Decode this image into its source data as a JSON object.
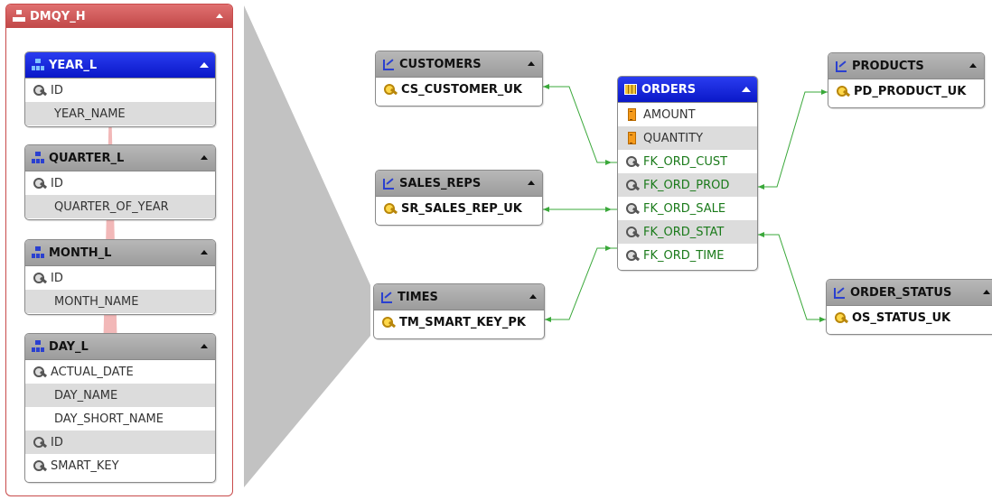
{
  "hierarchy": {
    "title": "DMQY_H",
    "levels": [
      {
        "name": "YEAR_L",
        "attributes": [
          "ID",
          "YEAR_NAME"
        ]
      },
      {
        "name": "QUARTER_L",
        "attributes": [
          "ID",
          "QUARTER_OF_YEAR"
        ]
      },
      {
        "name": "MONTH_L",
        "attributes": [
          "ID",
          "MONTH_NAME"
        ]
      },
      {
        "name": "DAY_L",
        "attributes": [
          "ACTUAL_DATE",
          "DAY_NAME",
          "DAY_SHORT_NAME",
          "ID",
          "SMART_KEY"
        ]
      }
    ]
  },
  "fact": {
    "name": "ORDERS",
    "measures": [
      "AMOUNT",
      "QUANTITY"
    ],
    "foreign_keys": [
      "FK_ORD_CUST",
      "FK_ORD_PROD",
      "FK_ORD_SALE",
      "FK_ORD_STAT",
      "FK_ORD_TIME"
    ]
  },
  "dimensions": [
    {
      "name": "CUSTOMERS",
      "key": "CS_CUSTOMER_UK"
    },
    {
      "name": "SALES_REPS",
      "key": "SR_SALES_REP_UK"
    },
    {
      "name": "TIMES",
      "key": "TM_SMART_KEY_PK"
    },
    {
      "name": "PRODUCTS",
      "key": "PD_PRODUCT_UK"
    },
    {
      "name": "ORDER_STATUS",
      "key": "OS_STATUS_UK"
    }
  ],
  "colors": {
    "hierarchy_border": "#c84a4a",
    "active_header": "#0a18c8",
    "connector": "#3aa83a",
    "fk_text": "#1a7a1a",
    "funnel": "#c0c0c0"
  },
  "icons": {
    "hierarchy": "hierarchy-icon",
    "level": "level-icon",
    "key": "key-icon",
    "measure": "measure-icon",
    "fact_table": "table-icon",
    "dimension": "dimension-icon",
    "collapse": "collapse-icon"
  }
}
